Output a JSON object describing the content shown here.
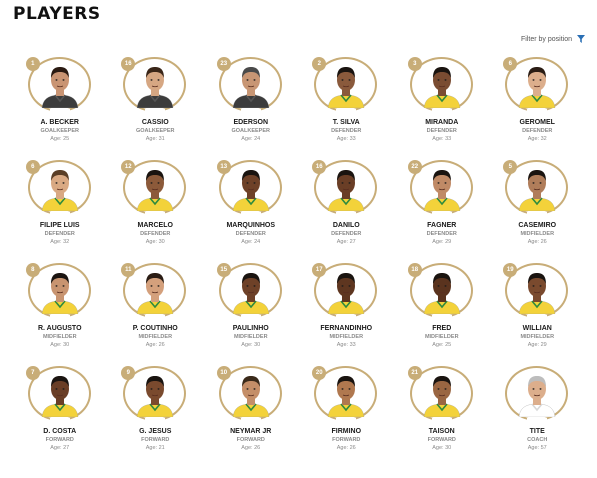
{
  "page": {
    "title": "PLAYERS",
    "filter_label": "Filter by position",
    "age_prefix": "Age:"
  },
  "colors": {
    "gold": "#c8ad78",
    "jersey_yellow": "#f3d23a",
    "jersey_green": "#2e8b3e",
    "coach_shirt": "#ffffff"
  },
  "players": [
    {
      "number": "1",
      "name": "A. BECKER",
      "position": "GOALKEEPER",
      "age": "25",
      "skin": "#c99473",
      "hair": "#2a1a12",
      "jersey": "gk",
      "icon": "player-photo-icon"
    },
    {
      "number": "16",
      "name": "CASSIO",
      "position": "GOALKEEPER",
      "age": "31",
      "skin": "#d6a783",
      "hair": "#3a2618",
      "jersey": "gk",
      "icon": "player-photo-icon"
    },
    {
      "number": "23",
      "name": "EDERSON",
      "position": "GOALKEEPER",
      "age": "24",
      "skin": "#c89674",
      "hair": "#4a4a4a",
      "jersey": "gk",
      "icon": "player-photo-icon"
    },
    {
      "number": "2",
      "name": "T. SILVA",
      "position": "DEFENDER",
      "age": "33",
      "skin": "#8a5a3c",
      "hair": "#1a1410",
      "jersey": "yellow",
      "icon": "player-photo-icon"
    },
    {
      "number": "3",
      "name": "MIRANDA",
      "position": "DEFENDER",
      "age": "33",
      "skin": "#7a4c32",
      "hair": "#1a1410",
      "jersey": "yellow",
      "icon": "player-photo-icon"
    },
    {
      "number": "6",
      "name": "GEROMEL",
      "position": "DEFENDER",
      "age": "32",
      "skin": "#dcae8c",
      "hair": "#2a1c14",
      "jersey": "yellow",
      "icon": "player-photo-icon"
    },
    {
      "number": "6",
      "name": "FILIPE LUIS",
      "position": "DEFENDER",
      "age": "32",
      "skin": "#d9a983",
      "hair": "#5a3e26",
      "jersey": "yellow",
      "icon": "player-photo-icon"
    },
    {
      "number": "12",
      "name": "MARCELO",
      "position": "DEFENDER",
      "age": "30",
      "skin": "#8c5a3a",
      "hair": "#1a1410",
      "jersey": "yellow",
      "icon": "player-photo-icon"
    },
    {
      "number": "13",
      "name": "MARQUINHOS",
      "position": "DEFENDER",
      "age": "24",
      "skin": "#6e4128",
      "hair": "#1a1410",
      "jersey": "yellow",
      "icon": "player-photo-icon"
    },
    {
      "number": "16",
      "name": "DANILO",
      "position": "DEFENDER",
      "age": "27",
      "skin": "#6a3e26",
      "hair": "#1a1410",
      "jersey": "yellow",
      "icon": "player-photo-icon"
    },
    {
      "number": "22",
      "name": "FAGNER",
      "position": "DEFENDER",
      "age": "29",
      "skin": "#c08a66",
      "hair": "#1a1410",
      "jersey": "yellow",
      "icon": "player-photo-icon"
    },
    {
      "number": "5",
      "name": "CASEMIRO",
      "position": "MIDFIELDER",
      "age": "26",
      "skin": "#b07d5a",
      "hair": "#1a1410",
      "jersey": "yellow",
      "icon": "player-photo-icon"
    },
    {
      "number": "8",
      "name": "R. AUGUSTO",
      "position": "MIDFIELDER",
      "age": "30",
      "skin": "#c89470",
      "hair": "#1a1410",
      "jersey": "yellow",
      "icon": "player-photo-icon"
    },
    {
      "number": "11",
      "name": "P. COUTINHO",
      "position": "MIDFIELDER",
      "age": "26",
      "skin": "#d4a07c",
      "hair": "#2a1c14",
      "jersey": "yellow",
      "icon": "player-photo-icon"
    },
    {
      "number": "15",
      "name": "PAULINHO",
      "position": "MIDFIELDER",
      "age": "30",
      "skin": "#6e4128",
      "hair": "#1a1410",
      "jersey": "yellow",
      "icon": "player-photo-icon"
    },
    {
      "number": "17",
      "name": "FERNANDINHO",
      "position": "MIDFIELDER",
      "age": "33",
      "skin": "#5e3620",
      "hair": "#1a1410",
      "jersey": "yellow",
      "icon": "player-photo-icon"
    },
    {
      "number": "18",
      "name": "FRED",
      "position": "MIDFIELDER",
      "age": "25",
      "skin": "#5a331e",
      "hair": "#1a1410",
      "jersey": "yellow",
      "icon": "player-photo-icon"
    },
    {
      "number": "19",
      "name": "WILLIAN",
      "position": "MIDFIELDER",
      "age": "29",
      "skin": "#7a4a2e",
      "hair": "#1a1410",
      "jersey": "yellow",
      "icon": "player-photo-icon"
    },
    {
      "number": "7",
      "name": "D. COSTA",
      "position": "FORWARD",
      "age": "27",
      "skin": "#6a3e26",
      "hair": "#1a1410",
      "jersey": "yellow",
      "icon": "player-photo-icon"
    },
    {
      "number": "9",
      "name": "G. JESUS",
      "position": "FORWARD",
      "age": "21",
      "skin": "#7a4a2e",
      "hair": "#1a1410",
      "jersey": "yellow",
      "icon": "player-photo-icon"
    },
    {
      "number": "10",
      "name": "NEYMAR JR",
      "position": "FORWARD",
      "age": "26",
      "skin": "#c48e68",
      "hair": "#3a2a1a",
      "jersey": "yellow",
      "icon": "player-photo-icon"
    },
    {
      "number": "20",
      "name": "FIRMINO",
      "position": "FORWARD",
      "age": "26",
      "skin": "#b0784f",
      "hair": "#1a1410",
      "jersey": "yellow",
      "icon": "player-photo-icon"
    },
    {
      "number": "21",
      "name": "TAISON",
      "position": "FORWARD",
      "age": "30",
      "skin": "#9a6642",
      "hair": "#1a1410",
      "jersey": "yellow",
      "icon": "player-photo-icon"
    },
    {
      "number": "",
      "name": "TITE",
      "position": "COACH",
      "age": "57",
      "skin": "#dcae8c",
      "hair": "#bdbdbd",
      "jersey": "coach",
      "icon": "coach-photo-icon"
    }
  ]
}
